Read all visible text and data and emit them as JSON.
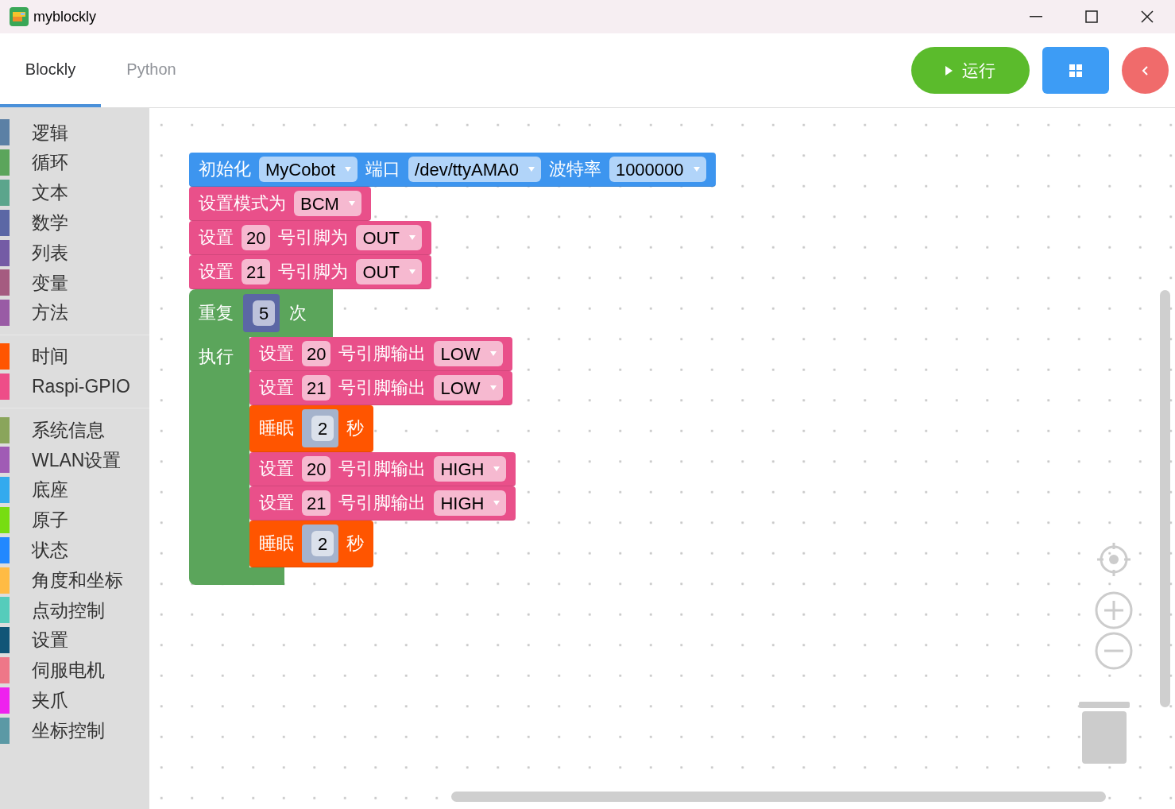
{
  "window": {
    "title": "myblockly"
  },
  "tabs": [
    {
      "label": "Blockly",
      "selected": true
    },
    {
      "label": "Python",
      "selected": false
    }
  ],
  "run_button": {
    "label": "运行"
  },
  "sidebar": {
    "groups": [
      {
        "items": [
          {
            "label": "逻辑",
            "color": "#5b80a5"
          },
          {
            "label": "循环",
            "color": "#5ba55b"
          },
          {
            "label": "文本",
            "color": "#5ba58c"
          },
          {
            "label": "数学",
            "color": "#5b67a5"
          },
          {
            "label": "列表",
            "color": "#745ba5"
          },
          {
            "label": "变量",
            "color": "#a55b80"
          },
          {
            "label": "方法",
            "color": "#995ba5"
          }
        ]
      },
      {
        "items": [
          {
            "label": "时间",
            "color": "#ff5500"
          },
          {
            "label": "Raspi-GPIO",
            "color": "#ee4d88"
          }
        ]
      },
      {
        "items": [
          {
            "label": "系统信息",
            "color": "#8aa55b"
          },
          {
            "label": "WLAN设置",
            "color": "#a05bb5"
          },
          {
            "label": "底座",
            "color": "#33aaee"
          },
          {
            "label": "原子",
            "color": "#77dd11"
          },
          {
            "label": "状态",
            "color": "#2288ff"
          },
          {
            "label": "角度和坐标",
            "color": "#ffbb44"
          },
          {
            "label": "点动控制",
            "color": "#55ccbb"
          },
          {
            "label": "设置",
            "color": "#115577"
          },
          {
            "label": "伺服电机",
            "color": "#ee7788"
          },
          {
            "label": "夹爪",
            "color": "#ee22ee"
          },
          {
            "label": "坐标控制",
            "color": "#5b99a5"
          }
        ]
      }
    ]
  },
  "blocks": [
    {
      "kind": "statement",
      "color": "#3d95ef",
      "parts": [
        {
          "kind": "label",
          "text": "初始化"
        },
        {
          "kind": "dropdown",
          "text": "MyCobot"
        },
        {
          "kind": "label",
          "text": "端口"
        },
        {
          "kind": "dropdown",
          "text": "/dev/ttyAMA0"
        },
        {
          "kind": "label",
          "text": "波特率"
        },
        {
          "kind": "dropdown",
          "text": "1000000"
        }
      ]
    },
    {
      "kind": "statement",
      "color": "#e9508a",
      "parts": [
        {
          "kind": "label",
          "text": "设置模式为"
        },
        {
          "kind": "dropdown",
          "text": "BCM"
        }
      ]
    },
    {
      "kind": "statement",
      "color": "#e9508a",
      "parts": [
        {
          "kind": "label",
          "text": "设置"
        },
        {
          "kind": "number",
          "text": "20"
        },
        {
          "kind": "label",
          "text": "号引脚为"
        },
        {
          "kind": "dropdown",
          "text": "OUT"
        }
      ]
    },
    {
      "kind": "statement",
      "color": "#e9508a",
      "parts": [
        {
          "kind": "label",
          "text": "设置"
        },
        {
          "kind": "number",
          "text": "21"
        },
        {
          "kind": "label",
          "text": "号引脚为"
        },
        {
          "kind": "dropdown",
          "text": "OUT"
        }
      ]
    },
    {
      "kind": "repeat",
      "color": "#5ba55b",
      "parts": [
        {
          "kind": "label",
          "text": "重复"
        },
        {
          "kind": "value",
          "text": "5",
          "color": "#5b67a5"
        },
        {
          "kind": "label",
          "text": "次"
        }
      ],
      "body_label": "执行",
      "children": [
        {
          "kind": "statement",
          "color": "#e9508a",
          "parts": [
            {
              "kind": "label",
              "text": "设置"
            },
            {
              "kind": "number",
              "text": "20"
            },
            {
              "kind": "label",
              "text": "号引脚输出"
            },
            {
              "kind": "dropdown",
              "text": "LOW"
            }
          ]
        },
        {
          "kind": "statement",
          "color": "#e9508a",
          "parts": [
            {
              "kind": "label",
              "text": "设置"
            },
            {
              "kind": "number",
              "text": "21"
            },
            {
              "kind": "label",
              "text": "号引脚输出"
            },
            {
              "kind": "dropdown",
              "text": "LOW"
            }
          ]
        },
        {
          "kind": "statement",
          "color": "#ff5500",
          "parts": [
            {
              "kind": "label",
              "text": "睡眠"
            },
            {
              "kind": "value",
              "text": "2",
              "color": "#a5b3cc"
            },
            {
              "kind": "label",
              "text": "秒"
            }
          ]
        },
        {
          "kind": "statement",
          "color": "#e9508a",
          "parts": [
            {
              "kind": "label",
              "text": "设置"
            },
            {
              "kind": "number",
              "text": "20"
            },
            {
              "kind": "label",
              "text": "号引脚输出"
            },
            {
              "kind": "dropdown",
              "text": "HIGH"
            }
          ]
        },
        {
          "kind": "statement",
          "color": "#e9508a",
          "parts": [
            {
              "kind": "label",
              "text": "设置"
            },
            {
              "kind": "number",
              "text": "21"
            },
            {
              "kind": "label",
              "text": "号引脚输出"
            },
            {
              "kind": "dropdown",
              "text": "HIGH"
            }
          ]
        },
        {
          "kind": "statement",
          "color": "#ff5500",
          "parts": [
            {
              "kind": "label",
              "text": "睡眠"
            },
            {
              "kind": "value",
              "text": "2",
              "color": "#a5b3cc"
            },
            {
              "kind": "label",
              "text": "秒"
            }
          ]
        }
      ]
    }
  ]
}
